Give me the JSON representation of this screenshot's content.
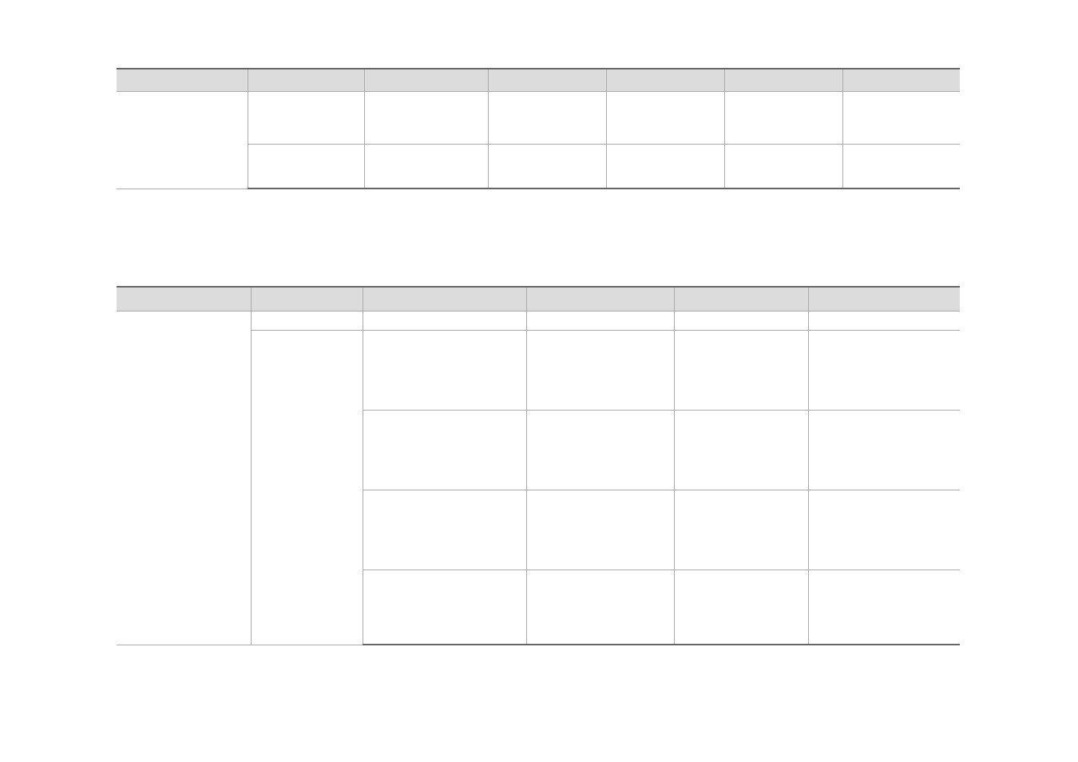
{
  "table1": {
    "headers": [
      "",
      "",
      "",
      "",
      "",
      "",
      ""
    ],
    "rows": [
      [
        "",
        "",
        "",
        "",
        "",
        "",
        ""
      ],
      [
        "",
        "",
        "",
        "",
        "",
        ""
      ]
    ]
  },
  "table2": {
    "headers": [
      "",
      "",
      "",
      "",
      "",
      ""
    ],
    "rows": [
      [
        "",
        "",
        "",
        "",
        "",
        ""
      ],
      [
        "",
        "",
        "",
        "",
        "",
        ""
      ],
      [
        "",
        "",
        "",
        "",
        ""
      ],
      [
        "",
        "",
        "",
        "",
        ""
      ],
      [
        "",
        "",
        "",
        "",
        ""
      ]
    ]
  }
}
